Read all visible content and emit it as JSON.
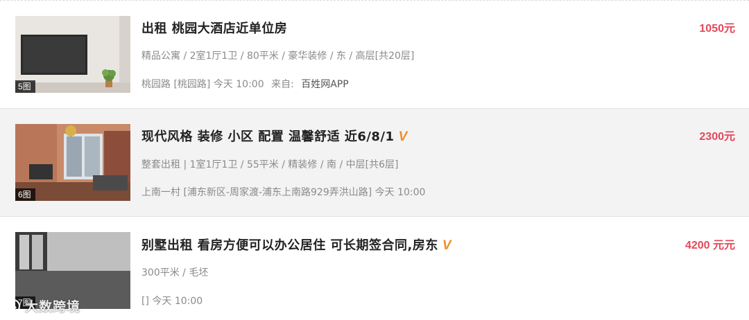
{
  "listings": [
    {
      "title": "出租 桃园大酒店近单位房",
      "verified_mark": "",
      "details": "精品公寓 / 2室1厅1卫 / 80平米 / 豪华装修 / 东 / 高层[共20层]",
      "location": "桃园路 [桃园路] 今天 10:00",
      "source_label": "来自:",
      "source_name": "百姓网APP",
      "price": "1050元",
      "photo_count": "5图"
    },
    {
      "title": "现代风格 装修 小区 配置 温馨舒适 近6/8/1",
      "verified_mark": "V",
      "details": "整套出租 | 1室1厅1卫 / 55平米 / 精装修 / 南 / 中层[共6层]",
      "location": "上南一村 [浦东新区-周家渡-浦东上南路929弄洪山路] 今天 10:00",
      "source_label": "",
      "source_name": "",
      "price": "2300元",
      "photo_count": "6图"
    },
    {
      "title": "别墅出租 看房方便可以办公居住 可长期签合同,房东",
      "verified_mark": "V",
      "details": "300平米 / 毛坯",
      "location": "[] 今天 10:00",
      "source_label": "",
      "source_name": "",
      "price": "4200 元元",
      "photo_count": "7图"
    }
  ],
  "watermark": "大数跨境",
  "colors": {
    "price": "#e5475a",
    "verified_badge": "#f28c28",
    "shaded_row": "#f3f3f3"
  },
  "icons": {
    "verified": "verified-v-icon",
    "watermark_logo": "brand-logo-icon"
  }
}
